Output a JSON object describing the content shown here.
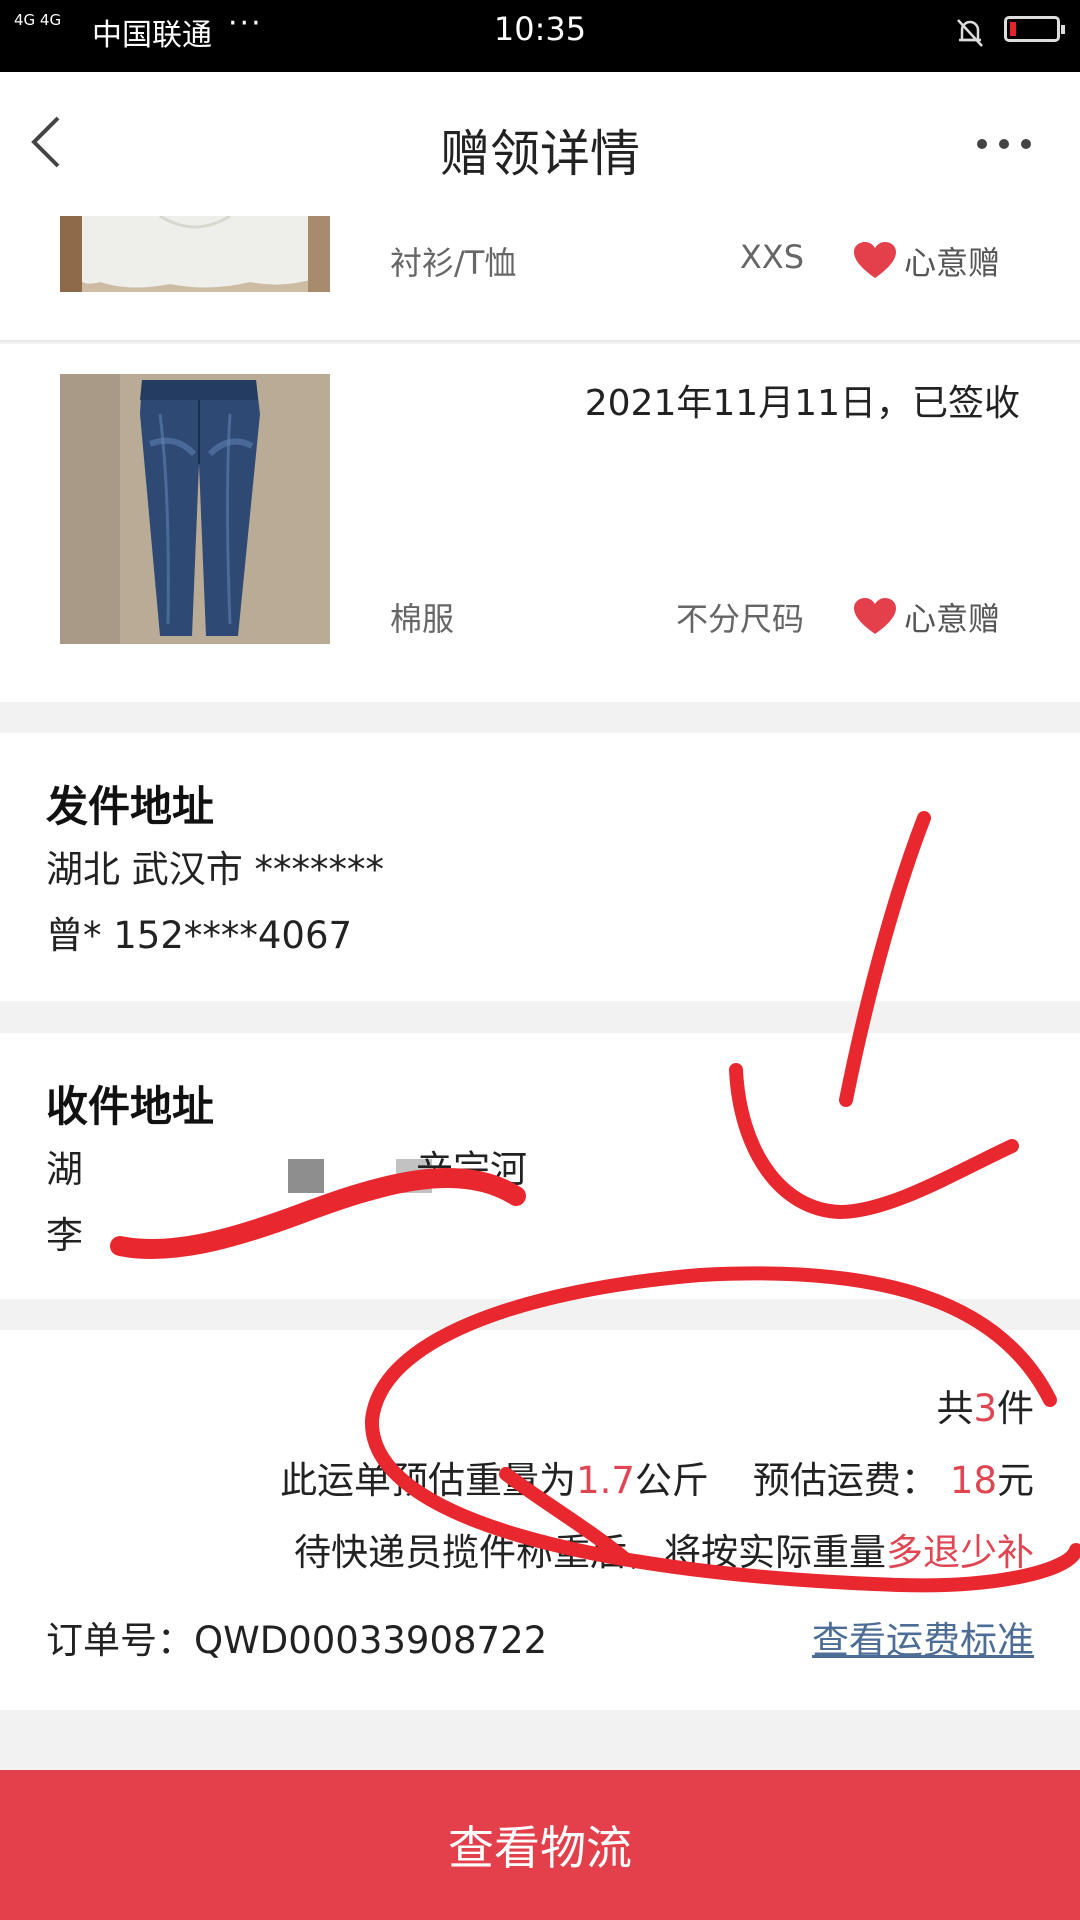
{
  "status_bar": {
    "signal": "4G 4G",
    "carrier": "中国联通",
    "more": "···",
    "time": "10:35"
  },
  "nav": {
    "title": "赠领详情"
  },
  "items": [
    {
      "category": "衬衫/T恤",
      "size": "XXS",
      "tag": "心意赠",
      "status": ""
    },
    {
      "category": "棉服",
      "size": "不分尺码",
      "tag": "心意赠",
      "status": "2021年11月11日，已签收"
    }
  ],
  "sender": {
    "title": "发件地址",
    "address": "湖北 武汉市 *******",
    "contact": "曾* 152****4067"
  },
  "receiver": {
    "title": "收件地址",
    "address_prefix": "湖",
    "address_suffix": "辛宗河",
    "contact_prefix": "李"
  },
  "summary": {
    "count_prefix": "共",
    "count": "3",
    "count_suffix": "件",
    "weight_prefix": "此运单预估重量为",
    "weight": "1.7",
    "weight_unit": "公斤",
    "fee_label": "预估运费：",
    "fee": "18",
    "fee_unit": "元",
    "note_prefix": "待快递员揽件称重后，将按实际重量",
    "note_highlight": "多退少补",
    "order_no": "订单号：QWD00033908722",
    "fee_link": "查看运费标准"
  },
  "bottom_button": {
    "label": "查看物流"
  },
  "colors": {
    "accent": "#e3404c",
    "highlight_red": "#e04552",
    "link_blue": "#4e6d96",
    "annotation_red": "#e8272e"
  }
}
